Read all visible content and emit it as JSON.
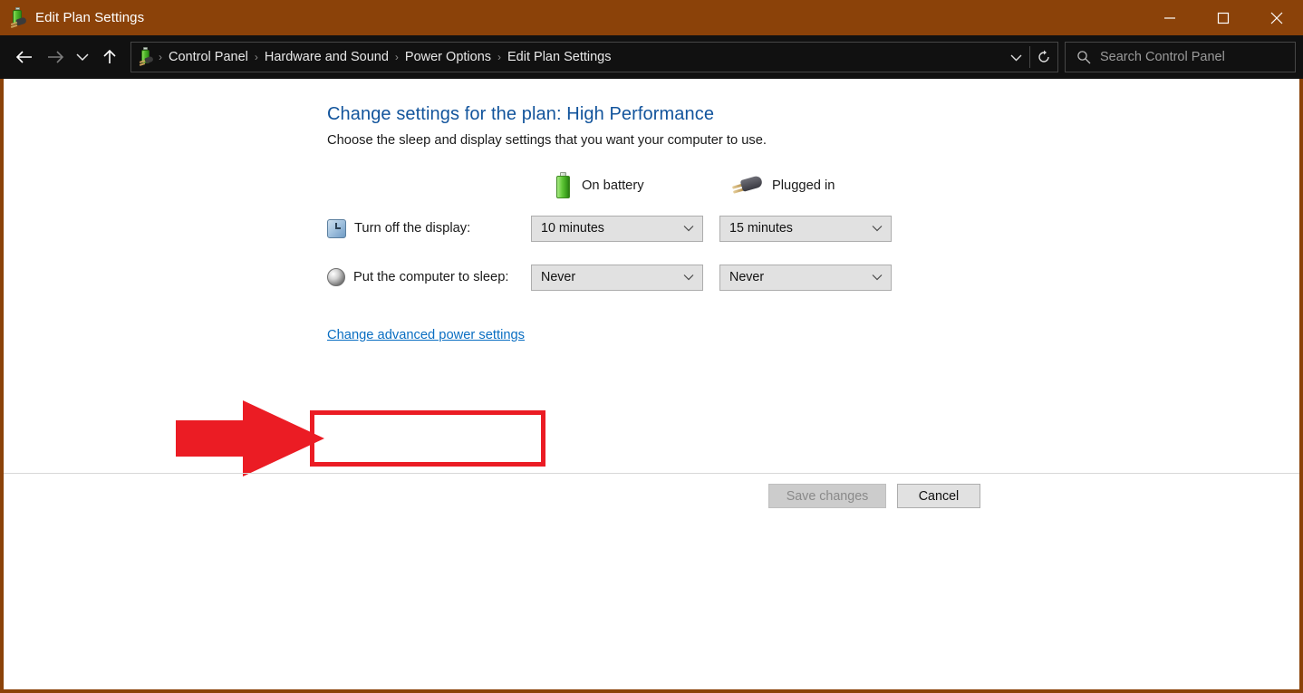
{
  "window": {
    "title": "Edit Plan Settings",
    "title_icon": "power-plan-icon",
    "titlebar_color": "#8b4209",
    "minimize_label": "Minimize",
    "maximize_label": "Maximize",
    "close_label": "Close"
  },
  "nav": {
    "back_label": "Back",
    "forward_label": "Forward",
    "recent_label": "Recent locations",
    "up_label": "Up one level",
    "breadcrumbs": [
      {
        "label": "Control Panel"
      },
      {
        "label": "Hardware and Sound"
      },
      {
        "label": "Power Options"
      },
      {
        "label": "Edit Plan Settings"
      }
    ],
    "separator": "›",
    "dropdown_label": "Previous locations",
    "refresh_label": "Refresh"
  },
  "search": {
    "placeholder": "Search Control Panel",
    "icon": "search-icon"
  },
  "main": {
    "title": "Change settings for the plan: High Performance",
    "subtitle": "Choose the sleep and display settings that you want your computer to use.",
    "title_color": "#12549c",
    "columns": [
      {
        "label": "On battery",
        "icon": "battery-icon"
      },
      {
        "label": "Plugged in",
        "icon": "power-plug-icon"
      }
    ],
    "rows": [
      {
        "label": "Turn off the display:",
        "icon": "display-clock-icon",
        "on_battery": "10 minutes",
        "plugged_in": "15 minutes"
      },
      {
        "label": "Put the computer to sleep:",
        "icon": "sleep-moon-icon",
        "on_battery": "Never",
        "plugged_in": "Never"
      }
    ],
    "advanced_link": "Change advanced power settings",
    "link_color": "#0a6ec2"
  },
  "buttons": {
    "save": "Save changes",
    "save_enabled": false,
    "cancel": "Cancel"
  },
  "annotation": {
    "color": "#eb1c24",
    "arrow_name": "red-pointer-arrow",
    "box_name": "red-highlight-box",
    "target": "Change advanced power settings"
  }
}
